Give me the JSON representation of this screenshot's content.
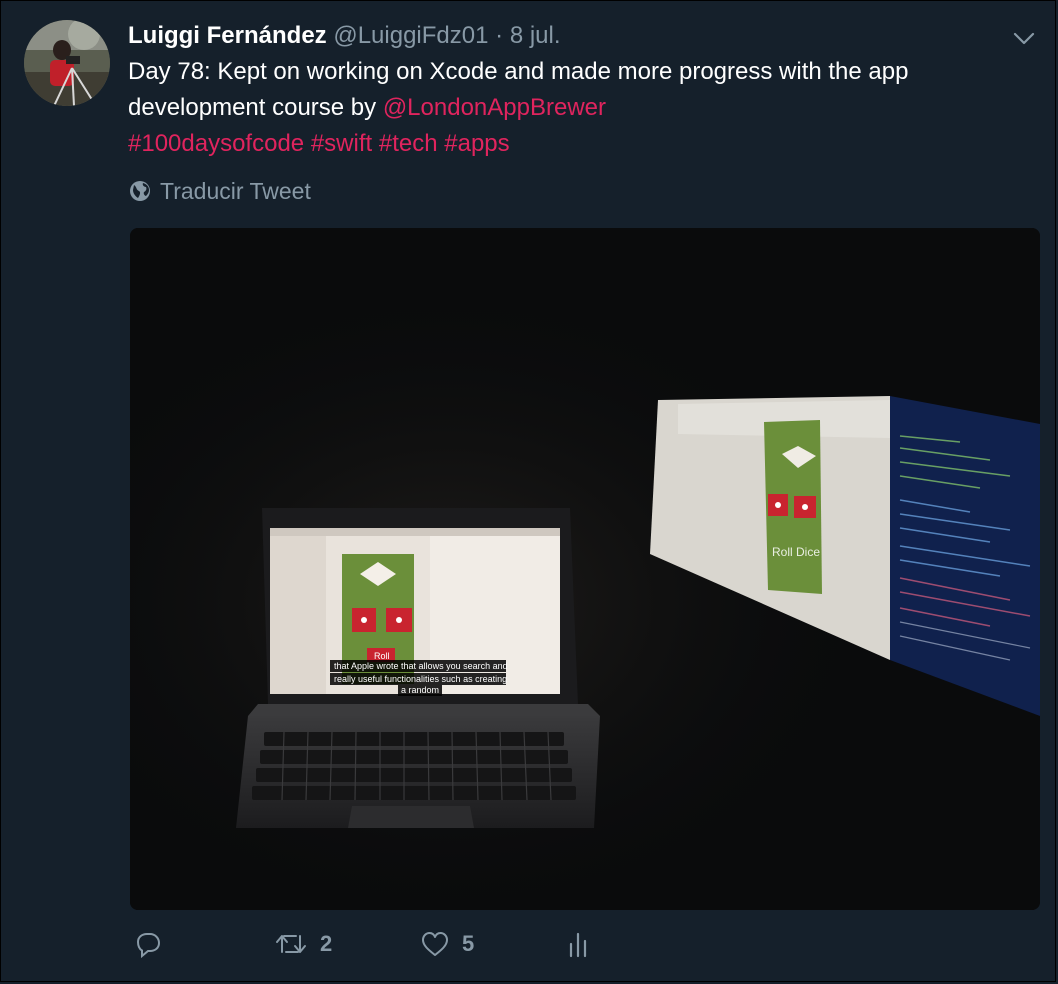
{
  "tweet": {
    "author_name": "Luiggi Fernández",
    "handle": "@LuiggiFdz01",
    "separator": "·",
    "date": "8 jul.",
    "text_part1": "Day 78: Kept on working on Xcode and made more progress with the app development course by ",
    "mention": "@LondonAppBrewer",
    "hashtags": [
      "#100daysofcode",
      "#swift",
      "#tech",
      "#apps"
    ],
    "translate_label": "Traducir Tweet",
    "photo": {
      "laptop_app_button": "Roll",
      "laptop_subtitle_line1": "that Apple wrote that allows you search and",
      "laptop_subtitle_line2": "really useful functionalities such as creating",
      "laptop_subtitle_line3": "a random",
      "projection_app_button": "Roll Dice"
    }
  },
  "actions": {
    "reply_count": "",
    "retweet_count": "2",
    "like_count": "5"
  },
  "colors": {
    "background": "#15202b",
    "link": "#e0245e",
    "secondary_text": "#8899a6"
  },
  "icons": {
    "menu": "chevron-down-icon",
    "translate": "globe-icon",
    "reply": "reply-icon",
    "retweet": "retweet-icon",
    "like": "heart-icon",
    "analytics": "analytics-icon"
  }
}
